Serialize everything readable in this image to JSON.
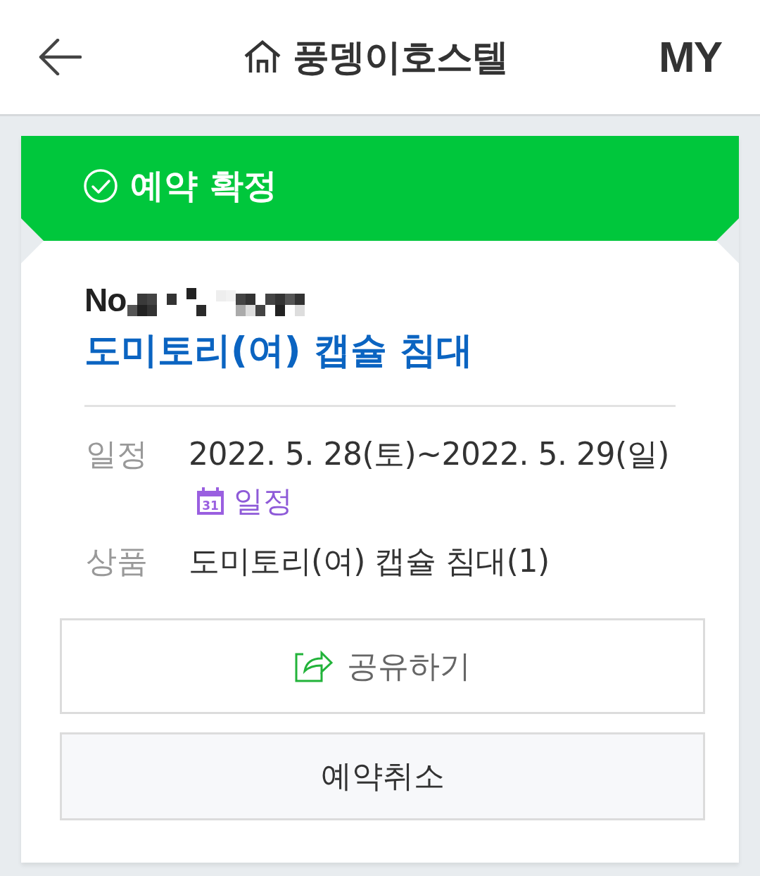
{
  "header": {
    "title": "풍뎅이호스텔",
    "my_link": "MY"
  },
  "status_banner": {
    "label": "예약 확정"
  },
  "reservation": {
    "number_label": "No",
    "room_title": "도미토리(여) 캡슐 침대",
    "details": [
      {
        "kind": "schedule",
        "label": "일정",
        "value": "2022. 5. 28(토)~2022. 5. 29(일)",
        "calendar_icon_day": "31",
        "calendar_link": "일정"
      },
      {
        "kind": "product",
        "label": "상품",
        "value": "도미토리(여) 캡슐 침대(1)"
      }
    ]
  },
  "buttons": [
    {
      "kind": "share",
      "label": "공유하기"
    },
    {
      "kind": "cancel",
      "label": "예약취소"
    }
  ]
}
